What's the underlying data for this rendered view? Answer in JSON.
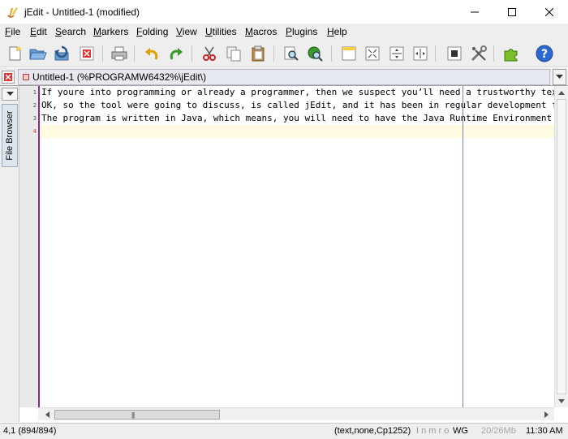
{
  "window": {
    "title": "jEdit - Untitled-1 (modified)",
    "icon": "jedit-logo-icon"
  },
  "menu": [
    {
      "label": "File",
      "mnemonic": "F",
      "rest": "ile"
    },
    {
      "label": "Edit",
      "mnemonic": "E",
      "rest": "dit"
    },
    {
      "label": "Search",
      "mnemonic": "S",
      "rest": "earch"
    },
    {
      "label": "Markers",
      "mnemonic": "M",
      "rest": "arkers"
    },
    {
      "label": "Folding",
      "mnemonic": "F",
      "rest": "olding"
    },
    {
      "label": "View",
      "mnemonic": "V",
      "rest": "iew"
    },
    {
      "label": "Utilities",
      "mnemonic": "U",
      "rest": "tilities"
    },
    {
      "label": "Macros",
      "mnemonic": "M",
      "rest": "acros"
    },
    {
      "label": "Plugins",
      "mnemonic": "P",
      "rest": "lugins"
    },
    {
      "label": "Help",
      "mnemonic": "H",
      "rest": "elp"
    }
  ],
  "toolbar": {
    "buttons": [
      "new-file",
      "open-file",
      "reload",
      "close",
      "print",
      "undo",
      "redo",
      "cut",
      "copy",
      "paste",
      "find",
      "find-in-files",
      "new-view",
      "split-horizontal",
      "split-vertical",
      "unsplit",
      "buffer-options",
      "global-options",
      "plugin-manager",
      "help"
    ]
  },
  "buffer_tab": {
    "label": "Untitled-1 (%PROGRAMW6432%\\jEdit\\)"
  },
  "dock": {
    "file_browser_label": "File Browser"
  },
  "editor": {
    "line_numbers": [
      "1",
      "2",
      "3",
      "4"
    ],
    "lines": [
      "If youre into programming or already a programmer, then we suspect you’ll need a trustworthy text",
      "OK, so the tool were going to discuss, is called jEdit, and it has been in regular development for",
      "The program is written in Java, which means, you will need to have the Java Runtime Environment so",
      ""
    ],
    "current_line": 4
  },
  "status": {
    "caret": "4,1 (894/894)",
    "buffer_info": "(text,none,Cp1252)",
    "modes": "I n m r o",
    "wg": "WG",
    "memory": "20/26Mb",
    "clock": "11:30 AM"
  },
  "colors": {
    "gutter_border": "#8a2a8a",
    "current_line_number": "#dd3333",
    "current_line_highlight": "#fffbe0"
  }
}
